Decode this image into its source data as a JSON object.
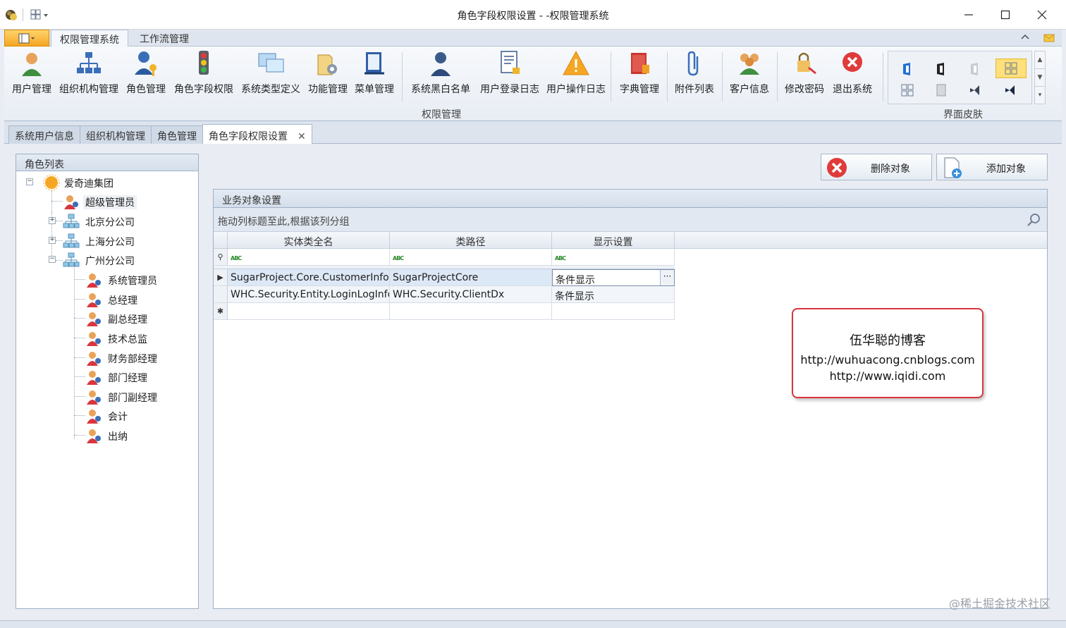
{
  "window": {
    "title": "角色字段权限设置 - -权限管理系统"
  },
  "ribbon_tabs": [
    {
      "label": "权限管理系统"
    },
    {
      "label": "工作流管理"
    }
  ],
  "ribbon": {
    "buttons": [
      {
        "label": "用户管理",
        "icon": "user-icon"
      },
      {
        "label": "组织机构管理",
        "icon": "org-chart-icon"
      },
      {
        "label": "角色管理",
        "icon": "role-key-icon"
      },
      {
        "label": "角色字段权限",
        "icon": "traffic-light-icon"
      },
      {
        "label": "系统类型定义",
        "icon": "system-type-icon"
      },
      {
        "label": "功能管理",
        "icon": "function-gear-icon"
      },
      {
        "label": "菜单管理",
        "icon": "menu-book-icon"
      },
      {
        "label": "系统黑白名单",
        "icon": "blacklist-user-icon"
      },
      {
        "label": "用户登录日志",
        "icon": "login-log-icon"
      },
      {
        "label": "用户操作日志",
        "icon": "warning-icon"
      },
      {
        "label": "字典管理",
        "icon": "dictionary-icon"
      },
      {
        "label": "附件列表",
        "icon": "paperclip-icon"
      },
      {
        "label": "客户信息",
        "icon": "customers-icon"
      },
      {
        "label": "修改密码",
        "icon": "password-key-icon"
      },
      {
        "label": "退出系统",
        "icon": "exit-icon"
      }
    ],
    "group_caption": "权限管理",
    "skin_caption": "界面皮肤"
  },
  "doc_tabs": [
    {
      "label": "系统用户信息"
    },
    {
      "label": "组织机构管理"
    },
    {
      "label": "角色管理"
    },
    {
      "label": "角色字段权限设置"
    }
  ],
  "left_panel": {
    "title": "角色列表",
    "tree": [
      {
        "label": "爱奇迪集团"
      },
      {
        "label": "超级管理员"
      },
      {
        "label": "北京分公司"
      },
      {
        "label": "上海分公司"
      },
      {
        "label": "广州分公司"
      },
      {
        "label": "系统管理员"
      },
      {
        "label": "总经理"
      },
      {
        "label": "副总经理"
      },
      {
        "label": "技术总监"
      },
      {
        "label": "财务部经理"
      },
      {
        "label": "部门经理"
      },
      {
        "label": "部门副经理"
      },
      {
        "label": "会计"
      },
      {
        "label": "出纳"
      }
    ]
  },
  "actions": {
    "delete_label": "删除对象",
    "add_label": "添加对象"
  },
  "biz_panel": {
    "title": "业务对象设置",
    "group_hint": "拖动列标题至此,根据该列分组",
    "columns": [
      "实体类全名",
      "类路径",
      "显示设置"
    ],
    "filter_icon_text": "ABC",
    "rows": [
      [
        "SugarProject.Core.CustomerInfo",
        "SugarProjectCore",
        "条件显示"
      ],
      [
        "WHC.Security.Entity.LoginLogInfo",
        "WHC.Security.ClientDx",
        "条件显示"
      ]
    ],
    "ellipsis": "···"
  },
  "blog": {
    "line1": "伍华聪的博客",
    "line2": "http://wuhuacong.cnblogs.com",
    "line3": "http://www.iqidi.com"
  },
  "watermark": "@稀土掘金技术社区",
  "colors": {
    "accent_orange": "#f5a623",
    "selection_blue": "#dde8f6",
    "red": "#d9363e"
  }
}
